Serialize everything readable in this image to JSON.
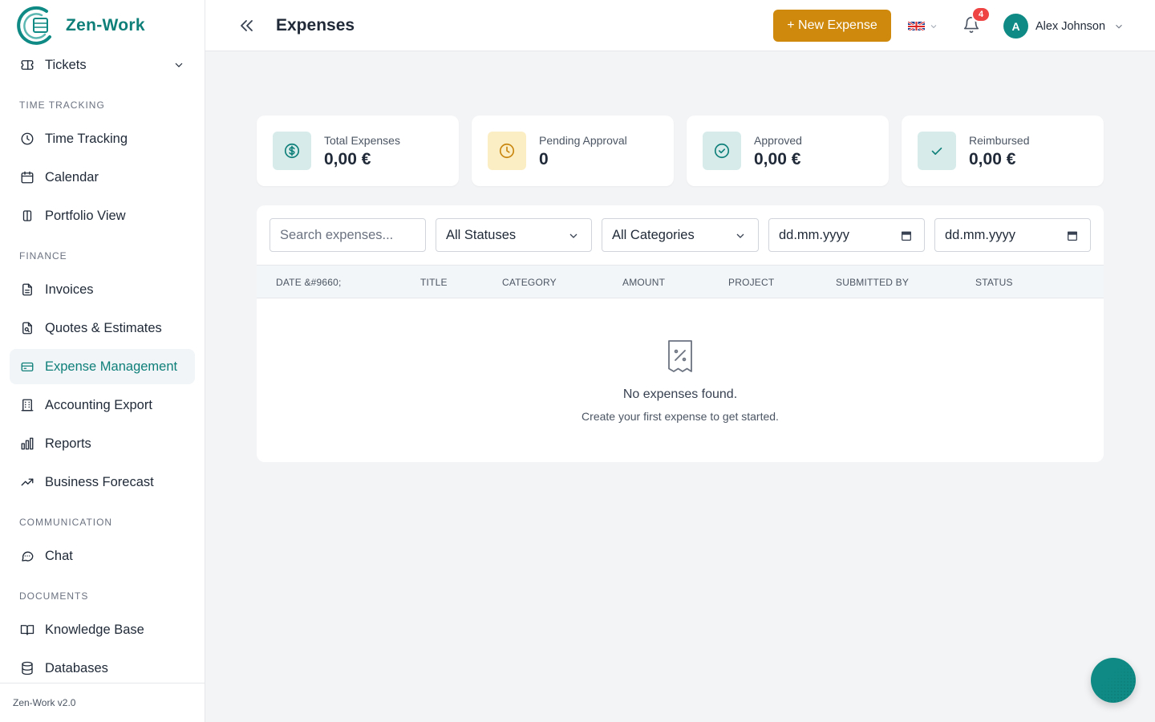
{
  "app": {
    "name": "Zen-Work",
    "version": "Zen-Work v2.0"
  },
  "colors": {
    "brand": "#0f7f7a",
    "accent": "#cf8a0e",
    "badge": "#ef4444",
    "active_bg": "#f1f5f7"
  },
  "sidebar": {
    "top_item": {
      "label": "Tickets",
      "icon": "ticket-icon"
    },
    "sections": [
      {
        "title": "Time Tracking",
        "items": [
          {
            "label": "Time Tracking",
            "icon": "clock-icon"
          },
          {
            "label": "Calendar",
            "icon": "calendar-icon"
          },
          {
            "label": "Portfolio View",
            "icon": "columns-icon"
          }
        ]
      },
      {
        "title": "Finance",
        "items": [
          {
            "label": "Invoices",
            "icon": "file-icon"
          },
          {
            "label": "Quotes & Estimates",
            "icon": "file-search-icon"
          },
          {
            "label": "Expense Management",
            "icon": "credit-card-icon",
            "active": true
          },
          {
            "label": "Accounting Export",
            "icon": "building-icon"
          },
          {
            "label": "Reports",
            "icon": "bar-chart-icon"
          },
          {
            "label": "Business Forecast",
            "icon": "trending-up-icon"
          }
        ]
      },
      {
        "title": "Communication",
        "items": [
          {
            "label": "Chat",
            "icon": "message-icon"
          }
        ]
      },
      {
        "title": "Documents",
        "items": [
          {
            "label": "Knowledge Base",
            "icon": "book-icon"
          },
          {
            "label": "Databases",
            "icon": "database-icon"
          }
        ]
      }
    ]
  },
  "header": {
    "title": "Expenses",
    "new_button": "+ New Expense",
    "language": "uk-flag-icon",
    "notification_count": "4",
    "user": {
      "initial": "A",
      "name": "Alex Johnson"
    }
  },
  "stats": [
    {
      "label": "Total Expenses",
      "value": "0,00 €",
      "icon": "dollar-circle-icon"
    },
    {
      "label": "Pending Approval",
      "value": "0",
      "icon": "clock-icon"
    },
    {
      "label": "Approved",
      "value": "0,00 €",
      "icon": "check-circle-icon"
    },
    {
      "label": "Reimbursed",
      "value": "0,00 €",
      "icon": "check-icon"
    }
  ],
  "filters": {
    "search_placeholder": "Search expenses...",
    "status": "All Statuses",
    "category": "All Categories",
    "date_from": "dd.mm.yyyy",
    "date_to": "dd.mm.yyyy"
  },
  "table": {
    "columns": [
      "DATE &#9660;",
      "TITLE",
      "CATEGORY",
      "AMOUNT",
      "PROJECT",
      "SUBMITTED BY",
      "STATUS"
    ],
    "empty_title": "No expenses found.",
    "empty_subtitle": "Create your first expense to get started."
  }
}
